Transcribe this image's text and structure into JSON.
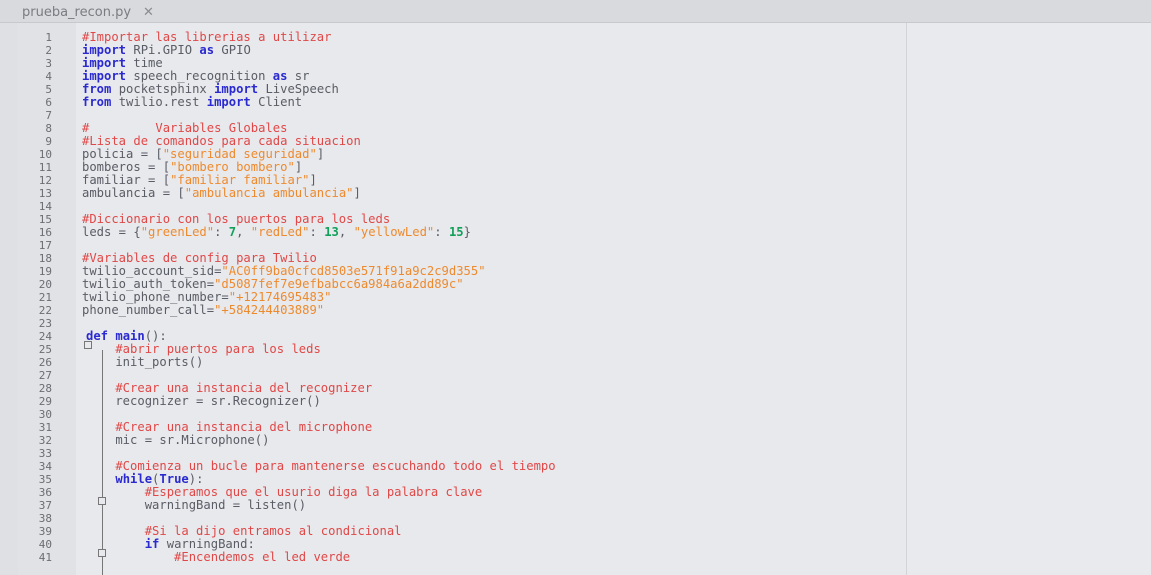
{
  "tab": {
    "filename": "prueba_recon.py",
    "close": "✕"
  },
  "lines": [
    {
      "n": "1",
      "t": [
        {
          "c": "#Importar las librerias a utilizar",
          "s": "c"
        }
      ]
    },
    {
      "n": "2",
      "t": [
        {
          "c": "import",
          "s": "k"
        },
        {
          "c": " RPi.GPIO ",
          "s": "p"
        },
        {
          "c": "as",
          "s": "k"
        },
        {
          "c": " GPIO",
          "s": "p"
        }
      ]
    },
    {
      "n": "3",
      "t": [
        {
          "c": "import",
          "s": "k"
        },
        {
          "c": " time",
          "s": "p"
        }
      ]
    },
    {
      "n": "4",
      "t": [
        {
          "c": "import",
          "s": "k"
        },
        {
          "c": " speech_recognition ",
          "s": "p"
        },
        {
          "c": "as",
          "s": "k"
        },
        {
          "c": " sr",
          "s": "p"
        }
      ]
    },
    {
      "n": "5",
      "t": [
        {
          "c": "from",
          "s": "k"
        },
        {
          "c": " pocketsphinx ",
          "s": "p"
        },
        {
          "c": "import",
          "s": "k"
        },
        {
          "c": " LiveSpeech",
          "s": "p"
        }
      ]
    },
    {
      "n": "6",
      "t": [
        {
          "c": "from",
          "s": "k"
        },
        {
          "c": " twilio.rest ",
          "s": "p"
        },
        {
          "c": "import",
          "s": "k"
        },
        {
          "c": " Client",
          "s": "p"
        }
      ]
    },
    {
      "n": "7",
      "t": []
    },
    {
      "n": "8",
      "t": [
        {
          "c": "#         Variables Globales",
          "s": "c"
        }
      ]
    },
    {
      "n": "9",
      "t": [
        {
          "c": "#Lista de comandos para cada situacion",
          "s": "c"
        }
      ]
    },
    {
      "n": "10",
      "t": [
        {
          "c": "policia = [",
          "s": "p"
        },
        {
          "c": "\"seguridad seguridad\"",
          "s": "s"
        },
        {
          "c": "]",
          "s": "p"
        }
      ]
    },
    {
      "n": "11",
      "t": [
        {
          "c": "bomberos = [",
          "s": "p"
        },
        {
          "c": "\"bombero bombero\"",
          "s": "s"
        },
        {
          "c": "]",
          "s": "p"
        }
      ]
    },
    {
      "n": "12",
      "t": [
        {
          "c": "familiar = [",
          "s": "p"
        },
        {
          "c": "\"familiar familiar\"",
          "s": "s"
        },
        {
          "c": "]",
          "s": "p"
        }
      ]
    },
    {
      "n": "13",
      "t": [
        {
          "c": "ambulancia = [",
          "s": "p"
        },
        {
          "c": "\"ambulancia ambulancia\"",
          "s": "s"
        },
        {
          "c": "]",
          "s": "p"
        }
      ]
    },
    {
      "n": "14",
      "t": []
    },
    {
      "n": "15",
      "t": [
        {
          "c": "#Diccionario con los puertos para los leds",
          "s": "c"
        }
      ]
    },
    {
      "n": "16",
      "t": [
        {
          "c": "leds = {",
          "s": "p"
        },
        {
          "c": "\"greenLed\"",
          "s": "s"
        },
        {
          "c": ": ",
          "s": "p"
        },
        {
          "c": "7",
          "s": "n"
        },
        {
          "c": ", ",
          "s": "p"
        },
        {
          "c": "\"redLed\"",
          "s": "s"
        },
        {
          "c": ": ",
          "s": "p"
        },
        {
          "c": "13",
          "s": "n"
        },
        {
          "c": ", ",
          "s": "p"
        },
        {
          "c": "\"yellowLed\"",
          "s": "s"
        },
        {
          "c": ": ",
          "s": "p"
        },
        {
          "c": "15",
          "s": "n"
        },
        {
          "c": "}",
          "s": "p"
        }
      ]
    },
    {
      "n": "17",
      "t": []
    },
    {
      "n": "18",
      "t": [
        {
          "c": "#Variables de config para Twilio",
          "s": "c"
        }
      ]
    },
    {
      "n": "19",
      "t": [
        {
          "c": "twilio_account_sid=",
          "s": "p"
        },
        {
          "c": "\"AC0ff9ba0cfcd8503e571f91a9c2c9d355\"",
          "s": "s"
        }
      ]
    },
    {
      "n": "20",
      "t": [
        {
          "c": "twilio_auth_token=",
          "s": "p"
        },
        {
          "c": "\"d5087fef7e9efbabcc6a984a6a2dd89c\"",
          "s": "s"
        }
      ]
    },
    {
      "n": "21",
      "t": [
        {
          "c": "twilio_phone_number=",
          "s": "p"
        },
        {
          "c": "\"+12174695483\"",
          "s": "s"
        }
      ]
    },
    {
      "n": "22",
      "t": [
        {
          "c": "phone_number_call=",
          "s": "p"
        },
        {
          "c": "\"+584244403889\"",
          "s": "s"
        }
      ]
    },
    {
      "n": "23",
      "t": []
    },
    {
      "n": "24",
      "t": [
        {
          "c": "def",
          "s": "k"
        },
        {
          "c": " ",
          "s": "p"
        },
        {
          "c": "main",
          "s": "k"
        },
        {
          "c": "():",
          "s": "p"
        }
      ]
    },
    {
      "n": "25",
      "t": [
        {
          "c": "    #abrir puertos para los leds",
          "s": "c"
        }
      ]
    },
    {
      "n": "26",
      "t": [
        {
          "c": "    init_ports()",
          "s": "p"
        }
      ]
    },
    {
      "n": "27",
      "t": []
    },
    {
      "n": "28",
      "t": [
        {
          "c": "    #Crear una instancia del recognizer",
          "s": "c"
        }
      ]
    },
    {
      "n": "29",
      "t": [
        {
          "c": "    recognizer = sr.Recognizer()",
          "s": "p"
        }
      ]
    },
    {
      "n": "30",
      "t": []
    },
    {
      "n": "31",
      "t": [
        {
          "c": "    #Crear una instancia del microphone",
          "s": "c"
        }
      ]
    },
    {
      "n": "32",
      "t": [
        {
          "c": "    mic = sr.Microphone()",
          "s": "p"
        }
      ]
    },
    {
      "n": "33",
      "t": []
    },
    {
      "n": "34",
      "t": [
        {
          "c": "    #Comienza un bucle para mantenerse escuchando todo el tiempo",
          "s": "c"
        }
      ]
    },
    {
      "n": "35",
      "t": [
        {
          "c": "    ",
          "s": "p"
        },
        {
          "c": "while",
          "s": "k"
        },
        {
          "c": "(",
          "s": "p"
        },
        {
          "c": "True",
          "s": "k"
        },
        {
          "c": "):",
          "s": "p"
        }
      ]
    },
    {
      "n": "36",
      "t": [
        {
          "c": "        #Esperamos que el usurio diga la palabra clave",
          "s": "c"
        }
      ]
    },
    {
      "n": "37",
      "t": [
        {
          "c": "        warningBand = listen()",
          "s": "p"
        }
      ]
    },
    {
      "n": "38",
      "t": []
    },
    {
      "n": "39",
      "t": [
        {
          "c": "        #Si la dijo entramos al condicional",
          "s": "c"
        }
      ]
    },
    {
      "n": "40",
      "t": [
        {
          "c": "        ",
          "s": "p"
        },
        {
          "c": "if",
          "s": "k"
        },
        {
          "c": " warningBand:",
          "s": "p"
        }
      ]
    },
    {
      "n": "41",
      "t": [
        {
          "c": "            #Encendemos el led verde",
          "s": "c"
        }
      ]
    }
  ]
}
